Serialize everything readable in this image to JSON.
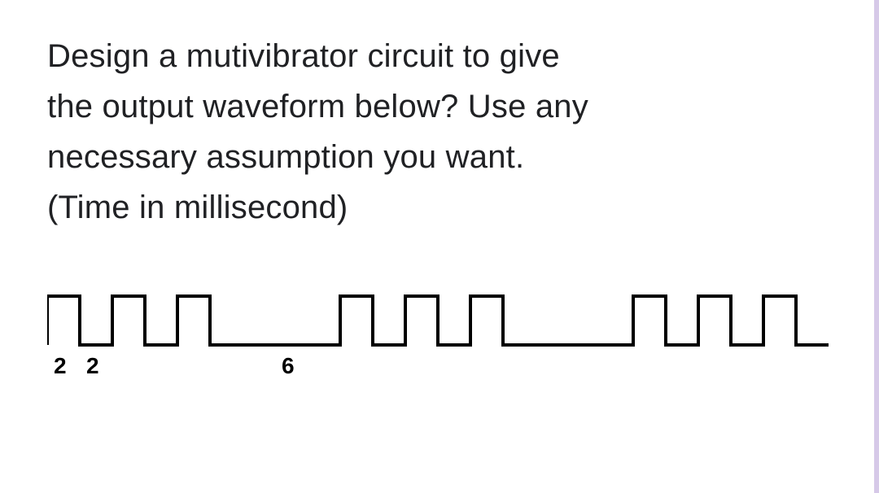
{
  "question": {
    "line1": "Design a mutivibrator circuit to give",
    "line2": "the output waveform below? Use any",
    "line3": "necessary assumption you want.",
    "line4": "(Time in millisecond)"
  },
  "waveform": {
    "high_ms": 2,
    "low_ms": 2,
    "gap_ms": 6,
    "pulses_per_burst": 3,
    "bursts_shown": 3,
    "time_unit": "millisecond"
  },
  "labels": {
    "high_label": "2",
    "low_label": "2",
    "gap_label": "6"
  }
}
